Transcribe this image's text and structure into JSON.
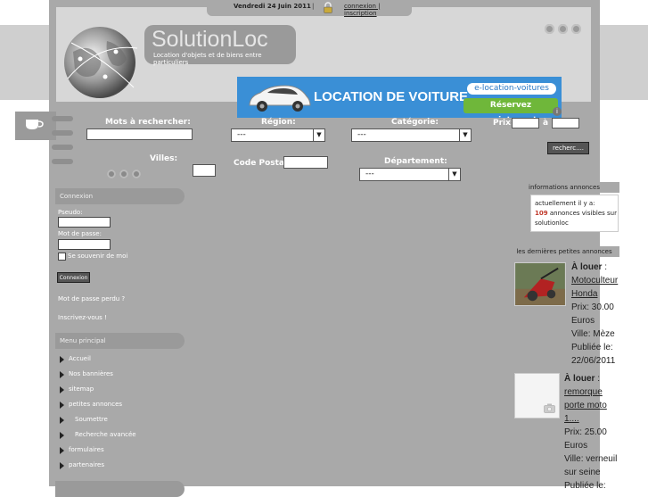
{
  "topbar": {
    "date": "Vendredi 24 Juin 2011",
    "separator": "|",
    "auth_links": "connexion | inscription"
  },
  "logo": {
    "name": "SolutionLoc",
    "tagline": "Location d'objets et de biens entre particuliers"
  },
  "banner": {
    "title": "LOCATION DE VOITURE",
    "brand": "e-location-voitures",
    "cta": "Réservez maintenant",
    "info": "i"
  },
  "search": {
    "keywords_label": "Mots à rechercher:",
    "region_label": "Région:",
    "region_value": "---",
    "category_label": "Catégorie:",
    "category_value": "---",
    "price_label": "Prix:",
    "price_to": "à",
    "city_label": "Villes:",
    "postal_label": "Code Postal:",
    "department_label": "Département:",
    "department_value": "---",
    "search_button": "recherc...."
  },
  "login": {
    "header": "Connexion",
    "pseudo_label": "Pseudo:",
    "password_label": "Mot de passe:",
    "remember_label": "Se souvenir de moi",
    "button": "Connexion",
    "forgot_link": "Mot de passe perdu ?",
    "register_link": "Inscrivez-vous !"
  },
  "menu": {
    "header": "Menu principal",
    "items": [
      {
        "label": "Accueil"
      },
      {
        "label": "Nos bannières"
      },
      {
        "label": "sitemap"
      },
      {
        "label": "petites annonces"
      },
      {
        "label": "Soumettre"
      },
      {
        "label": "Recherche avancée"
      },
      {
        "label": "formulaires"
      },
      {
        "label": "partenaires"
      }
    ]
  },
  "info": {
    "header": "informations annonces",
    "line1": "actuellement il y a:",
    "count": "109",
    "line2": " annonces visibles sur",
    "line3": "solutionloc"
  },
  "latest": {
    "header": "les dernières petites annonces",
    "ads": [
      {
        "type": "À louer",
        "colon": " :",
        "title_lines": [
          "Motoculteur",
          "Honda"
        ],
        "price": "Prix: 30.00",
        "currency": "Euros",
        "city": "Ville: Mèze",
        "published_label": "Publiée le:",
        "published_date": "22/06/2011"
      },
      {
        "type": "À louer",
        "colon": " :",
        "title_lines": [
          "remorque",
          "porte moto",
          "1...."
        ],
        "price": "Prix: 25.00",
        "currency": "Euros",
        "city_lines": [
          "Ville: verneuil",
          "sur seine"
        ],
        "published_label": "Publiée le:"
      }
    ]
  }
}
